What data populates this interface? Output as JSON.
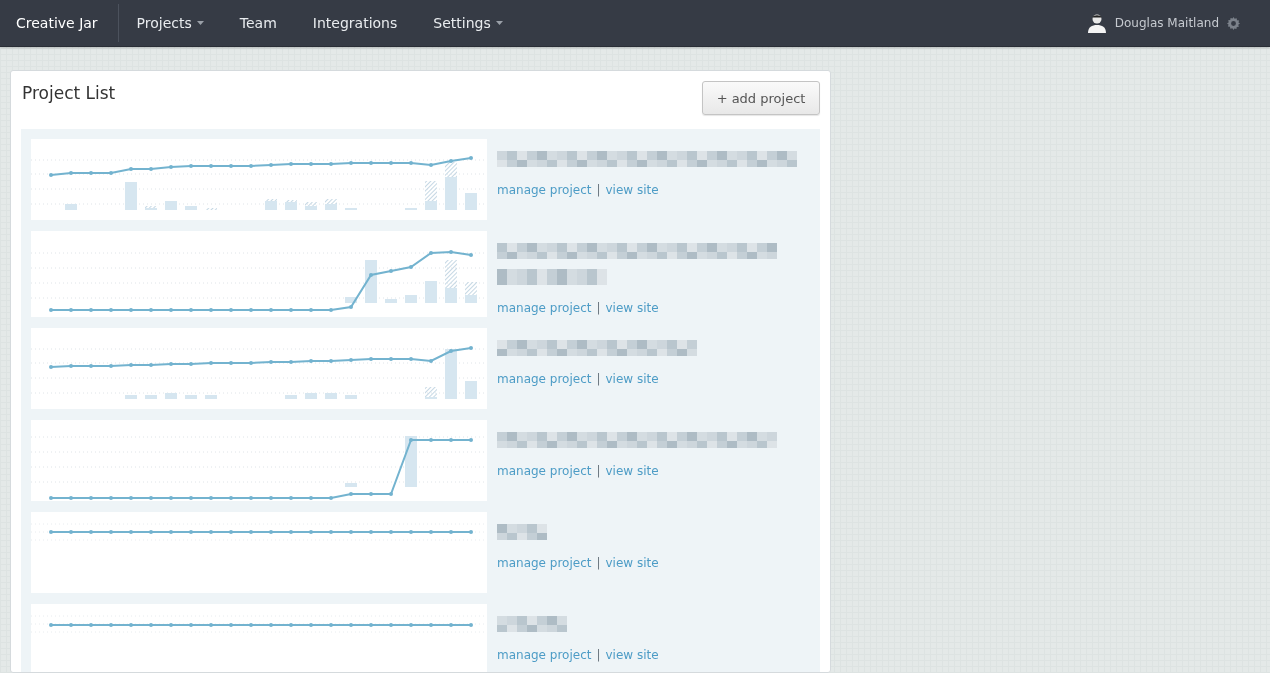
{
  "navbar": {
    "brand": "Creative Jar",
    "items": [
      {
        "label": "Projects",
        "dropdown": true
      },
      {
        "label": "Team",
        "dropdown": false
      },
      {
        "label": "Integrations",
        "dropdown": false
      },
      {
        "label": "Settings",
        "dropdown": true
      }
    ],
    "user": {
      "name": "Douglas Maitland"
    }
  },
  "panel": {
    "title": "Project List",
    "add_button": "+ add project",
    "projects": [
      {
        "links": [
          "manage project",
          "view site"
        ],
        "separator": "|"
      },
      {
        "links": [
          "manage project",
          "view site"
        ],
        "separator": "|"
      },
      {
        "links": [
          "manage project",
          "view site"
        ],
        "separator": "|"
      },
      {
        "links": [
          "manage project",
          "view site"
        ],
        "separator": "|"
      },
      {
        "links": [
          "manage project",
          "view site"
        ],
        "separator": "|"
      },
      {
        "links": [
          "manage project",
          "view site"
        ],
        "separator": "|"
      }
    ]
  }
}
